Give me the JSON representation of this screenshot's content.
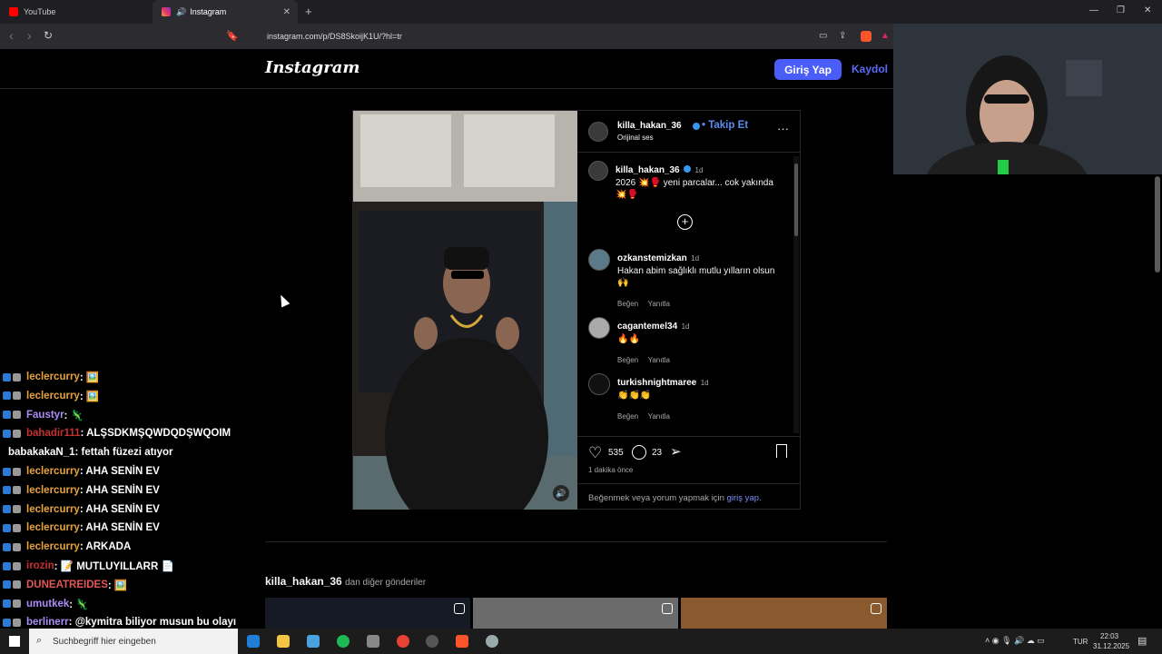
{
  "browser": {
    "tabs": [
      {
        "label": "YouTube",
        "color": "#ff0000"
      },
      {
        "label": "Instagram",
        "color": "#e1306c"
      }
    ],
    "url": "instagram.com/p/DS8SkoijK1U/?hl=tr"
  },
  "ig": {
    "logo": "Instagram",
    "login": "Giriş Yap",
    "signup": "Kaydol"
  },
  "post": {
    "author": "killa_hakan_36",
    "follow": "• Takip Et",
    "audio": "Orijinal ses",
    "caption": {
      "user": "killa_hakan_36",
      "time": "1d",
      "text": "2026 💥🥊 yeni parcalar... cok yakında",
      "text2": "💥🥊"
    },
    "comments": [
      {
        "user": "ozkanstemizkan",
        "time": "1d",
        "text": "Hakan abim sağlıklı mutlu yılların olsun",
        "text2": "🙌",
        "like": "Beğen",
        "reply": "Yanıtla"
      },
      {
        "user": "cagantemel34",
        "time": "1d",
        "text": "🔥🔥",
        "like": "Beğen",
        "reply": "Yanıtla"
      },
      {
        "user": "turkishnightmaree",
        "time": "1d",
        "text": "👏👏👏",
        "like": "Beğen",
        "reply": "Yanıtla"
      }
    ],
    "likes": "535",
    "comments_count": "23",
    "ago": "1 dakika önce",
    "login_prompt": "Beğenmek veya yorum yapmak için",
    "login_link": "giriş yap",
    "login_end": "."
  },
  "more": {
    "user": "killa_hakan_36",
    "suffix": "dan diğer gönderiler"
  },
  "chat": [
    {
      "user": "leclercurry",
      "msg": " : 🖼️",
      "color": "#e7a33b"
    },
    {
      "user": "leclercurry",
      "msg": " : 🖼️",
      "color": "#e7a33b"
    },
    {
      "user": "Faustyr",
      "msg": " : 🦎",
      "color": "#a98df5"
    },
    {
      "user": "bahadir111",
      "msg": " : ALŞSDKMŞQWDQDŞWQOIM",
      "color": "#c82f2f"
    },
    {
      "user": "babakakaN_1",
      "msg": " : fettah füzezi atıyor",
      "color": "#ffffff"
    },
    {
      "user": "leclercurry",
      "msg": " : AHA SENİN EV",
      "color": "#e7a33b"
    },
    {
      "user": "leclercurry",
      "msg": " : AHA SENİN EV",
      "color": "#e7a33b"
    },
    {
      "user": "leclercurry",
      "msg": " : AHA SENİN EV",
      "color": "#e7a33b"
    },
    {
      "user": "leclercurry",
      "msg": " : AHA SENİN EV",
      "color": "#e7a33b"
    },
    {
      "user": "leclercurry",
      "msg": " : ARKADA",
      "color": "#e7a33b"
    },
    {
      "user": "irozin",
      "msg": " : 📝 MUTLUYILLARR 📄",
      "color": "#c82f2f"
    },
    {
      "user": "DUNEATREIDES",
      "msg": " : 🖼️",
      "color": "#e55656"
    },
    {
      "user": "umutkek",
      "msg": " : 🦎",
      "color": "#a98df5"
    },
    {
      "user": "berlinerr",
      "msg": " : @kymitra biliyor musun bu olayı",
      "color": "#a98df5"
    }
  ],
  "taskbar": {
    "search": "Suchbegriff hier eingeben",
    "lang": "TUR",
    "time": "22:03",
    "date": "31.12.2025"
  }
}
